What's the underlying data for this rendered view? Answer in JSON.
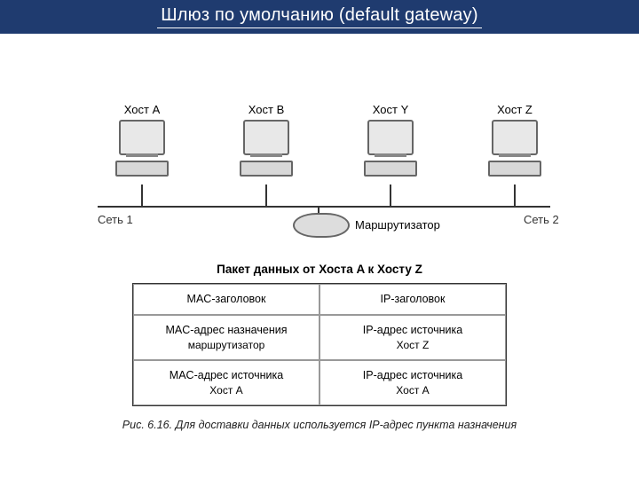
{
  "title": "Шлюз по умолчанию (default gateway)",
  "hosts": {
    "a": "Хост A",
    "b": "Хост B",
    "y": "Хост Y",
    "z": "Хост Z"
  },
  "nets": {
    "n1": "Сеть 1",
    "n2": "Сеть 2"
  },
  "router_label": "Маршрутизатор",
  "packet_title": "Пакет данных от Хоста A к Хосту Z",
  "packet": {
    "mac_header": "MAC-заголовок",
    "ip_header": "IP-заголовок",
    "mac_dest_l1": "MAC-адрес назначения",
    "mac_dest_l2": "маршрутизатор",
    "ip_dest_l1": "IP-адрес источника",
    "ip_dest_l2": "Хост Z",
    "mac_src_l1": "MAC-адрес источника",
    "mac_src_l2": "Хост A",
    "ip_src_l1": "IP-адрес источника",
    "ip_src_l2": "Хост A"
  },
  "caption_prefix": "Рис. 6.16.",
  "caption_text": "Для доставки данных используется IP-адрес пункта назначения"
}
